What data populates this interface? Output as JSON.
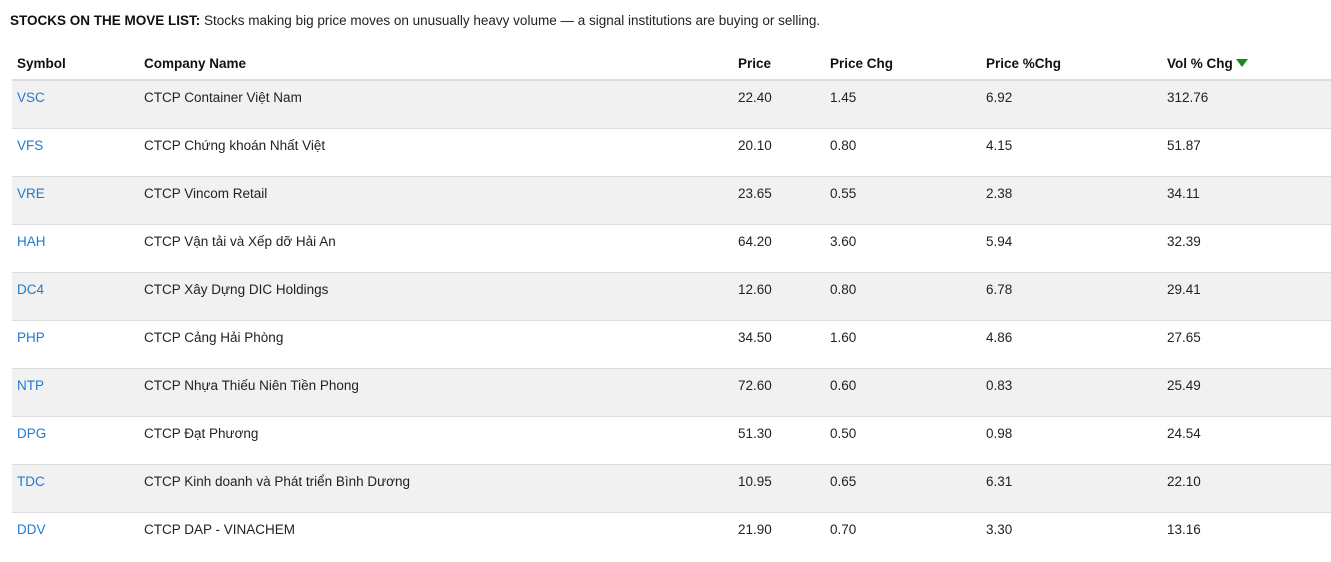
{
  "header": {
    "title": "STOCKS ON THE MOVE LIST:",
    "description": "Stocks making big price moves on unusually heavy volume — a signal institutions are buying or selling."
  },
  "table": {
    "columns": {
      "symbol": "Symbol",
      "company": "Company Name",
      "price": "Price",
      "price_chg": "Price Chg",
      "price_pct_chg": "Price %Chg",
      "vol_pct_chg": "Vol % Chg"
    },
    "sort": {
      "column": "vol_pct_chg",
      "direction": "descending",
      "icon": "sort-desc-icon",
      "color": "#178a17"
    },
    "rows": [
      {
        "symbol": "VSC",
        "company": "CTCP Container Việt Nam",
        "price": "22.40",
        "price_chg": "1.45",
        "price_pct_chg": "6.92",
        "vol_pct_chg": "312.76"
      },
      {
        "symbol": "VFS",
        "company": "CTCP Chứng khoán Nhất Việt",
        "price": "20.10",
        "price_chg": "0.80",
        "price_pct_chg": "4.15",
        "vol_pct_chg": "51.87"
      },
      {
        "symbol": "VRE",
        "company": "CTCP Vincom Retail",
        "price": "23.65",
        "price_chg": "0.55",
        "price_pct_chg": "2.38",
        "vol_pct_chg": "34.11"
      },
      {
        "symbol": "HAH",
        "company": "CTCP Vận tải và Xếp dỡ Hải An",
        "price": "64.20",
        "price_chg": "3.60",
        "price_pct_chg": "5.94",
        "vol_pct_chg": "32.39"
      },
      {
        "symbol": "DC4",
        "company": "CTCP Xây Dựng DIC Holdings",
        "price": "12.60",
        "price_chg": "0.80",
        "price_pct_chg": "6.78",
        "vol_pct_chg": "29.41"
      },
      {
        "symbol": "PHP",
        "company": "CTCP Cảng Hải Phòng",
        "price": "34.50",
        "price_chg": "1.60",
        "price_pct_chg": "4.86",
        "vol_pct_chg": "27.65"
      },
      {
        "symbol": "NTP",
        "company": "CTCP Nhựa Thiếu Niên Tiền Phong",
        "price": "72.60",
        "price_chg": "0.60",
        "price_pct_chg": "0.83",
        "vol_pct_chg": "25.49"
      },
      {
        "symbol": "DPG",
        "company": "CTCP Đạt Phương",
        "price": "51.30",
        "price_chg": "0.50",
        "price_pct_chg": "0.98",
        "vol_pct_chg": "24.54"
      },
      {
        "symbol": "TDC",
        "company": "CTCP Kinh doanh và Phát triển Bình Dương",
        "price": "10.95",
        "price_chg": "0.65",
        "price_pct_chg": "6.31",
        "vol_pct_chg": "22.10"
      },
      {
        "symbol": "DDV",
        "company": "CTCP DAP - VINACHEM",
        "price": "21.90",
        "price_chg": "0.70",
        "price_pct_chg": "3.30",
        "vol_pct_chg": "13.16"
      }
    ]
  },
  "colors": {
    "link": "#1e7ad4",
    "row_alt": "#f1f1f1",
    "border": "#dddddd"
  }
}
